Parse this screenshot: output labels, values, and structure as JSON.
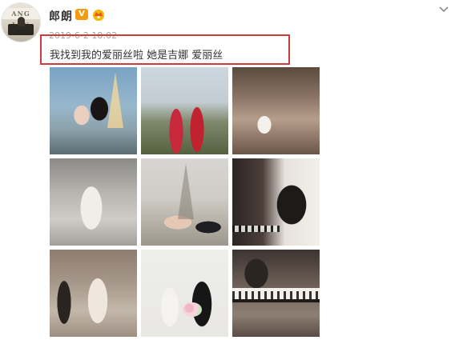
{
  "post": {
    "user": {
      "name": "郎朗",
      "verified_badge": "V",
      "avatar_banner": "ANG LAN"
    },
    "time": "2019-6-2 18:02",
    "text": "我找到我的爱丽丝啦 她是吉娜 爱丽丝",
    "highlight_color": "#cf3b3b",
    "photos": [
      {
        "name": "eiffel-tower-couple-photo"
      },
      {
        "name": "red-traditional-outfit-photo"
      },
      {
        "name": "paris-cafe-photo"
      },
      {
        "name": "bride-veil-photo"
      },
      {
        "name": "hands-eiffel-tower-photo"
      },
      {
        "name": "piano-player-photo"
      },
      {
        "name": "bride-window-photo"
      },
      {
        "name": "couple-bouquet-photo"
      },
      {
        "name": "couple-piano-keys-photo"
      }
    ]
  },
  "icons": {
    "verified": "verified-v-icon",
    "crown": "crown-icon",
    "menu": "chevron-down-icon"
  },
  "colors": {
    "accent_orange": "#f39c12",
    "time_gray": "#a0a0a0"
  }
}
